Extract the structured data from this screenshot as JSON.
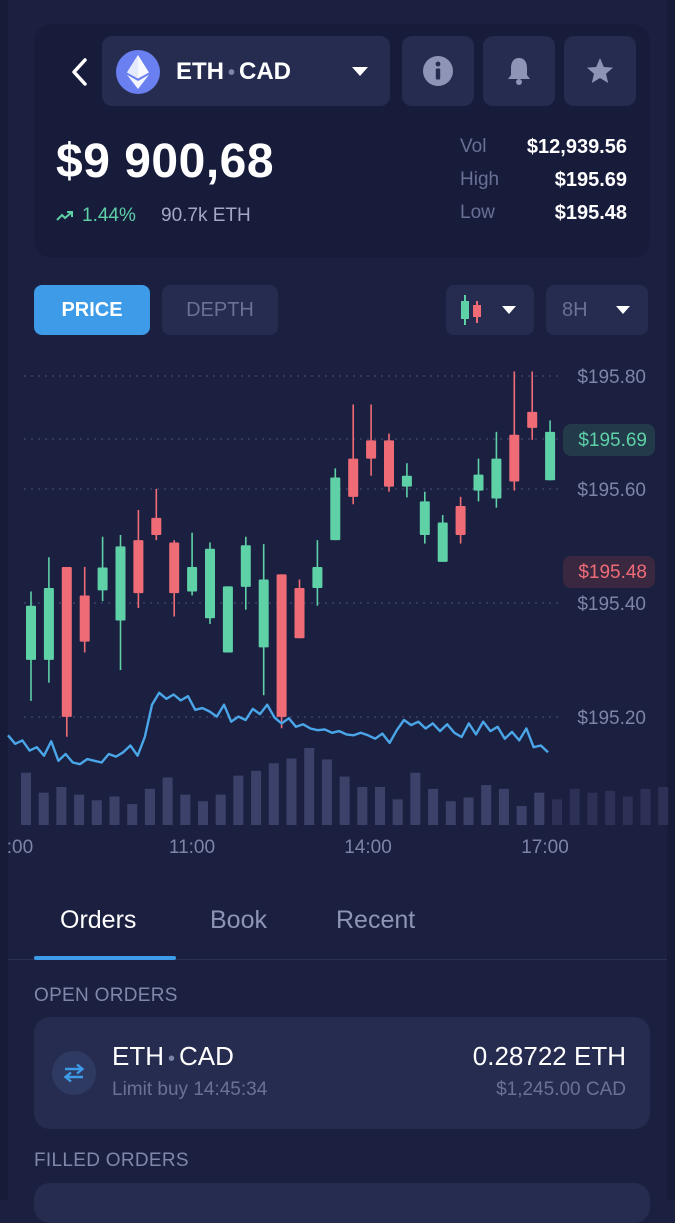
{
  "header": {
    "pair_base": "ETH",
    "pair_sep": "•",
    "pair_quote": "CAD",
    "price": "$9 900,68",
    "change": "1.44%",
    "volume_24h": "90.7k ETH",
    "stats": [
      {
        "label": "Vol",
        "value": "$12,939.56"
      },
      {
        "label": "High",
        "value": "$195.69"
      },
      {
        "label": "Low",
        "value": "$195.48"
      }
    ]
  },
  "icons": {
    "back": "chevron-left-icon",
    "coin": "ethereum-icon",
    "info": "info-icon",
    "alert": "bell-icon",
    "favorite": "star-icon",
    "chart_type": "candlestick-icon",
    "order": "swap-arrows-icon"
  },
  "toolbar": {
    "price_tab": "PRICE",
    "depth_tab": "DEPTH",
    "timeframe": "8H"
  },
  "colors": {
    "up": "#5ed1a7",
    "down": "#ef6c77",
    "accent": "#3d9be8",
    "line": "#4aa6e8",
    "volume": "#3c4169",
    "volume_faded": "#2c3155"
  },
  "chart_data": {
    "type": "candlestick",
    "y_ticks": [
      "$195.80",
      "$195.60",
      "$195.40",
      "$195.20"
    ],
    "high_label": "$195.69",
    "low_label": "$195.48",
    "x_ticks": [
      ":00",
      "11:00",
      "14:00",
      "17:00"
    ],
    "grid": "horizontal dotted",
    "candles": [
      {
        "o": 195.397,
        "c": 195.302,
        "h": 195.422,
        "l": 195.23,
        "d": "up"
      },
      {
        "o": 195.302,
        "c": 195.428,
        "h": 195.482,
        "l": 195.262,
        "d": "up"
      },
      {
        "o": 195.465,
        "c": 195.202,
        "h": 195.465,
        "l": 195.167,
        "d": "down"
      },
      {
        "o": 195.415,
        "c": 195.334,
        "h": 195.465,
        "l": 195.315,
        "d": "down"
      },
      {
        "o": 195.424,
        "c": 195.464,
        "h": 195.518,
        "l": 195.405,
        "d": "up"
      },
      {
        "o": 195.371,
        "c": 195.501,
        "h": 195.521,
        "l": 195.284,
        "d": "up"
      },
      {
        "o": 195.512,
        "c": 195.419,
        "h": 195.565,
        "l": 195.393,
        "d": "down"
      },
      {
        "o": 195.551,
        "c": 195.521,
        "h": 195.602,
        "l": 195.512,
        "d": "down"
      },
      {
        "o": 195.508,
        "c": 195.419,
        "h": 195.512,
        "l": 195.378,
        "d": "down"
      },
      {
        "o": 195.422,
        "c": 195.465,
        "h": 195.525,
        "l": 195.415,
        "d": "up"
      },
      {
        "o": 195.375,
        "c": 195.497,
        "h": 195.508,
        "l": 195.365,
        "d": "up"
      },
      {
        "o": 195.315,
        "c": 195.431,
        "h": 195.431,
        "l": 195.315,
        "d": "up"
      },
      {
        "o": 195.43,
        "c": 195.503,
        "h": 195.518,
        "l": 195.39,
        "d": "up"
      },
      {
        "o": 195.324,
        "c": 195.443,
        "h": 195.505,
        "l": 195.24,
        "d": "up"
      },
      {
        "o": 195.452,
        "c": 195.202,
        "h": 195.452,
        "l": 195.182,
        "d": "down"
      },
      {
        "o": 195.428,
        "c": 195.34,
        "h": 195.443,
        "l": 195.34,
        "d": "down"
      },
      {
        "o": 195.428,
        "c": 195.465,
        "h": 195.512,
        "l": 195.397,
        "d": "up"
      },
      {
        "o": 195.512,
        "c": 195.622,
        "h": 195.638,
        "l": 195.512,
        "d": "up"
      },
      {
        "o": 195.655,
        "c": 195.588,
        "h": 195.75,
        "l": 195.575,
        "d": "down"
      },
      {
        "o": 195.687,
        "c": 195.655,
        "h": 195.75,
        "l": 195.625,
        "d": "down"
      },
      {
        "o": 195.687,
        "c": 195.606,
        "h": 195.699,
        "l": 195.597,
        "d": "down"
      },
      {
        "o": 195.606,
        "c": 195.625,
        "h": 195.647,
        "l": 195.587,
        "d": "up"
      },
      {
        "o": 195.521,
        "c": 195.58,
        "h": 195.597,
        "l": 195.506,
        "d": "up"
      },
      {
        "o": 195.474,
        "c": 195.543,
        "h": 195.556,
        "l": 195.474,
        "d": "up"
      },
      {
        "o": 195.572,
        "c": 195.521,
        "h": 195.588,
        "l": 195.506,
        "d": "down"
      },
      {
        "o": 195.599,
        "c": 195.627,
        "h": 195.655,
        "l": 195.58,
        "d": "up"
      },
      {
        "o": 195.585,
        "c": 195.655,
        "h": 195.702,
        "l": 195.569,
        "d": "up"
      },
      {
        "o": 195.697,
        "c": 195.615,
        "h": 195.808,
        "l": 195.599,
        "d": "down"
      },
      {
        "o": 195.737,
        "c": 195.709,
        "h": 195.808,
        "l": 195.688,
        "d": "down"
      },
      {
        "o": 195.617,
        "c": 195.702,
        "h": 195.722,
        "l": 195.617,
        "d": "up"
      }
    ],
    "volume": [
      0.55,
      0.34,
      0.4,
      0.32,
      0.26,
      0.3,
      0.22,
      0.38,
      0.5,
      0.32,
      0.25,
      0.32,
      0.52,
      0.57,
      0.65,
      0.7,
      0.81,
      0.69,
      0.51,
      0.4,
      0.4,
      0.27,
      0.55,
      0.38,
      0.25,
      0.29,
      0.42,
      0.38,
      0.2,
      0.34,
      0.27,
      0.38,
      0.34,
      0.36,
      0.3,
      0.38,
      0.4,
      0.36,
      0.28,
      0.42
    ],
    "line": [
      0.42,
      0.32,
      0.36,
      0.24,
      0.28,
      0.18,
      0.35,
      0.12,
      0.2,
      0.1,
      0.08,
      0.14,
      0.12,
      0.1,
      0.2,
      0.17,
      0.22,
      0.3,
      0.18,
      0.4,
      0.78,
      0.92,
      0.85,
      0.9,
      0.83,
      0.88,
      0.72,
      0.74,
      0.7,
      0.64,
      0.78,
      0.58,
      0.64,
      0.6,
      0.73,
      0.67,
      0.78,
      0.63,
      0.56,
      0.62,
      0.52,
      0.55,
      0.5,
      0.48,
      0.49,
      0.45,
      0.47,
      0.43,
      0.42,
      0.45,
      0.42,
      0.38,
      0.44,
      0.33,
      0.48,
      0.6,
      0.54,
      0.58,
      0.5,
      0.56,
      0.47,
      0.55,
      0.45,
      0.4,
      0.56,
      0.43,
      0.58,
      0.47,
      0.52,
      0.38,
      0.46,
      0.36,
      0.5,
      0.28,
      0.3,
      0.22
    ]
  },
  "orders": {
    "tabs": [
      "Orders",
      "Book",
      "Recent"
    ],
    "open_title": "OPEN ORDERS",
    "open": {
      "base": "ETH",
      "sep": "•",
      "quote": "CAD",
      "type": "Limit buy",
      "time": "14:45:34",
      "amount": "0.28722 ETH",
      "amount_cad": "$1,245.00 CAD"
    },
    "filled_title": "FILLED ORDERS"
  }
}
